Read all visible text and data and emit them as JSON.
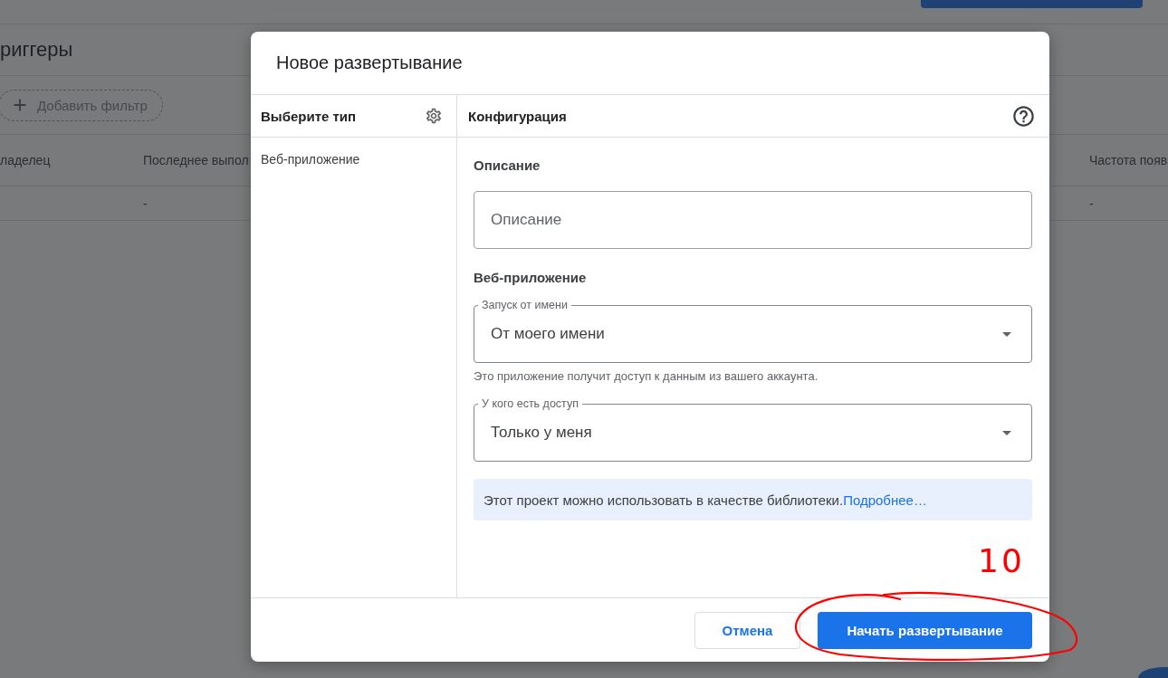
{
  "page": {
    "title": "риггеры",
    "filter_button": "Добавить фильтр",
    "table": {
      "columns": [
        "ладелец",
        "Последнее выпол",
        "Частота появ"
      ],
      "rows": [
        {
          "column_2": "-",
          "column_3": "-"
        }
      ]
    }
  },
  "dialog": {
    "title": "Новое развертывание",
    "type_panel": {
      "heading": "Выберите тип",
      "items": [
        "Веб-приложение"
      ]
    },
    "config_panel": {
      "heading": "Конфигурация",
      "description": {
        "label": "Описание",
        "placeholder": "Описание"
      },
      "web_app": {
        "label": "Веб-приложение",
        "run_as": {
          "label": "Запуск от имени",
          "value": "От моего имени"
        },
        "run_as_hint": "Это приложение получит доступ к данным из вашего аккаунта.",
        "access": {
          "label": "У кого есть доступ",
          "value": "Только у меня"
        }
      },
      "info": {
        "text": "Этот проект можно использовать в качестве библиотеки.",
        "link": "Подробнее…"
      }
    },
    "buttons": [
      {
        "label": "Отмена",
        "kind": "secondary"
      },
      {
        "label": "Начать развертывание",
        "kind": "primary"
      }
    ]
  },
  "annotation": {
    "note": "10"
  }
}
